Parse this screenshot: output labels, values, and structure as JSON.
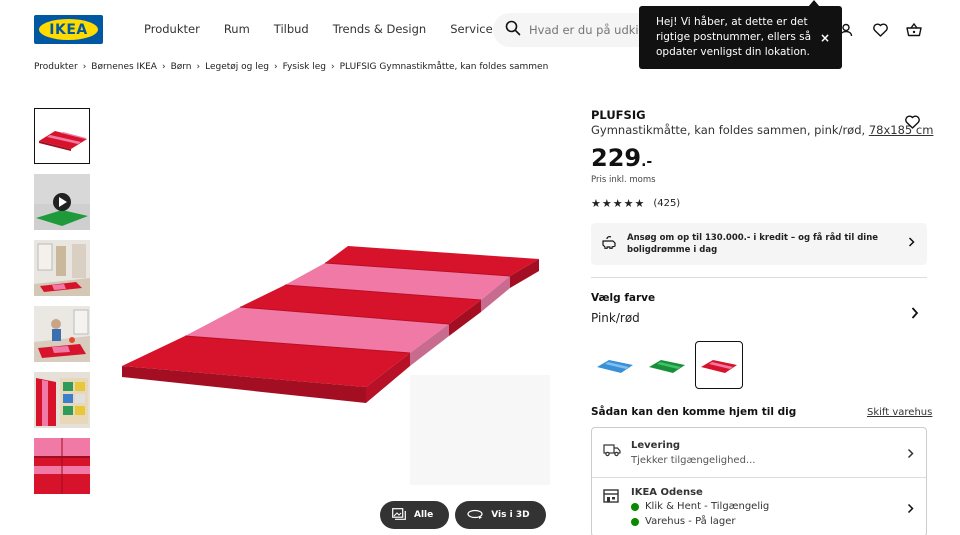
{
  "header": {
    "logo_text": "IKEA",
    "nav": [
      "Produkter",
      "Rum",
      "Tilbud",
      "Trends & Design",
      "Servicer"
    ],
    "search_placeholder": "Hvad er du på udkig efter?"
  },
  "tooltip": {
    "text": "Hej! Vi håber, at dette er det rigtige postnummer, ellers så opdater venligst din lokation.",
    "close": "×"
  },
  "breadcrumb": [
    "Produkter",
    "Børnenes IKEA",
    "Børn",
    "Legetøj og leg",
    "Fysisk leg",
    "PLUFSIG Gymnastikmåtte, kan foldes sammen"
  ],
  "image_buttons": {
    "all": "Alle",
    "view3d": "Vis i 3D"
  },
  "product": {
    "name": "PLUFSIG",
    "description": "Gymnastikmåtte, kan foldes sammen, pink/rød,",
    "size": "78x185 cm",
    "price": "229",
    "price_suffix": ".-",
    "price_note": "Pris inkl. moms",
    "stars": "★★★★★",
    "rating_count": "(425)",
    "rating_value": 4.6
  },
  "credit": {
    "text": "Ansøg om op til 130.000.- i kredit – og få råd til dine boligdrømme i dag"
  },
  "color": {
    "label": "Vælg farve",
    "value": "Pink/rød",
    "options": [
      "blue",
      "green",
      "pink-red"
    ],
    "selected": "pink-red"
  },
  "delivery": {
    "title": "Sådan kan den komme hjem til dig",
    "change_store": "Skift varehus",
    "shipping_title": "Levering",
    "shipping_status": "Tjekker tilgængelighed...",
    "store_name": "IKEA Odense",
    "click_collect": "Klik & Hent - Tilgængelig",
    "in_store": "Varehus - På lager"
  },
  "colors": {
    "ikea_blue": "#0058a3",
    "ikea_yellow": "#ffdb00",
    "mat_red": "#d6132b",
    "mat_pink": "#f07aa5",
    "in_stock": "#0a8a00"
  }
}
